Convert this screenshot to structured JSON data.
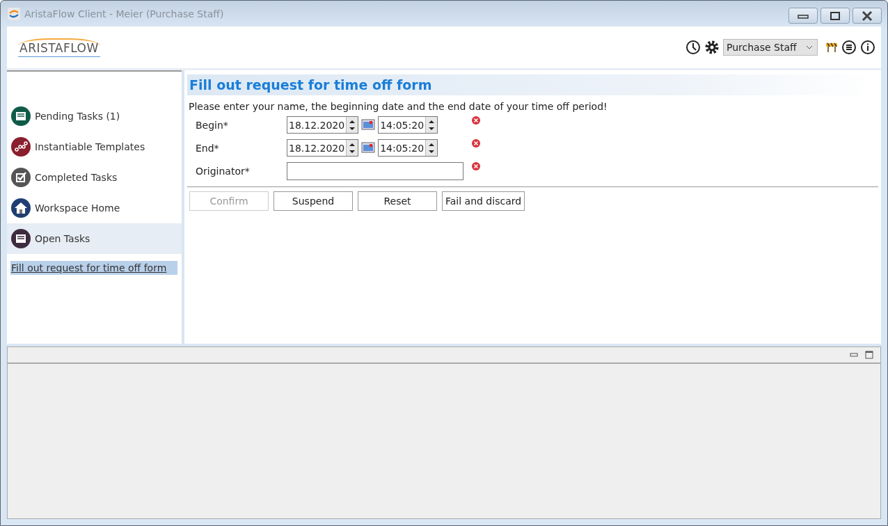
{
  "window": {
    "title": "AristaFlow Client - Meier (Purchase Staff)"
  },
  "header": {
    "logo": "ARISTAFLOW",
    "role_select": {
      "value": "Purchase Staff"
    }
  },
  "sidebar": {
    "items": [
      {
        "label": "Pending Tasks (1)",
        "kind": "pending",
        "selected": false
      },
      {
        "label": "Instantiable Templates",
        "kind": "templates",
        "selected": false
      },
      {
        "label": "Completed Tasks",
        "kind": "completed",
        "selected": false
      },
      {
        "label": "Workspace Home",
        "kind": "home",
        "selected": false
      },
      {
        "label": "Open Tasks",
        "kind": "open",
        "selected": true
      }
    ],
    "open_tasks": [
      {
        "label": "Fill out request for time off form",
        "selected": true
      }
    ]
  },
  "form": {
    "title": "Fill out request for time off form",
    "instruction": "Please enter your name, the beginning date and the end date of your time off period!",
    "fields": [
      {
        "label": "Begin*",
        "kind": "datetime",
        "date": "18.12.2020",
        "time": "14:05:20",
        "error": true
      },
      {
        "label": "End*",
        "kind": "datetime",
        "date": "18.12.2020",
        "time": "14:05:20",
        "error": true
      },
      {
        "label": "Originator*",
        "kind": "text",
        "error": true
      }
    ],
    "buttons": [
      {
        "label": "Confirm",
        "disabled": true
      },
      {
        "label": "Suspend",
        "disabled": false
      },
      {
        "label": "Reset",
        "disabled": false
      },
      {
        "label": "Fail and discard",
        "disabled": false
      }
    ]
  }
}
